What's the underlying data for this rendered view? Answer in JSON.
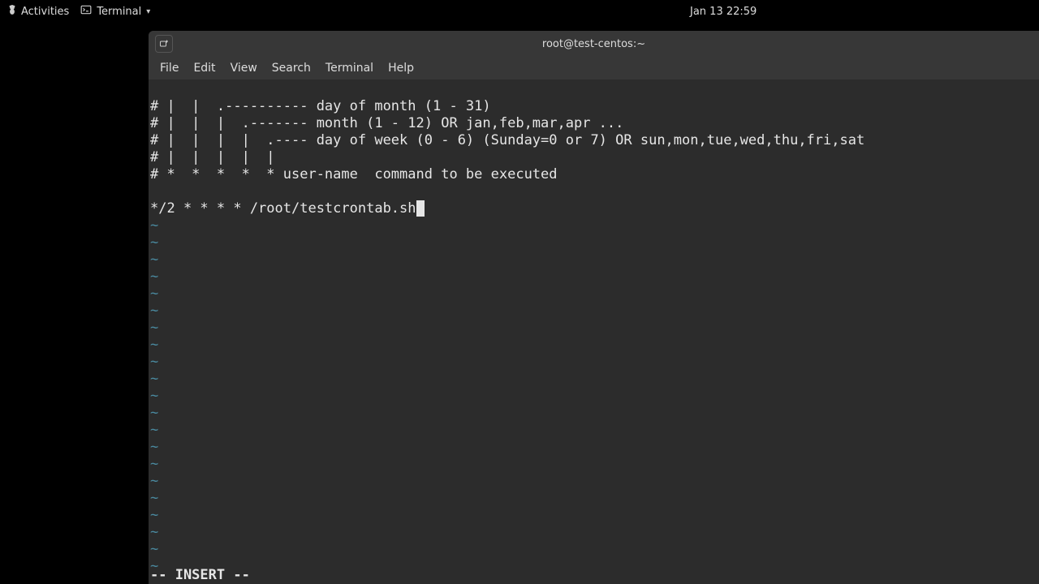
{
  "topbar": {
    "activities": "Activities",
    "app": "Terminal",
    "clock": "Jan 13  22:59"
  },
  "window": {
    "title": "root@test-centos:~"
  },
  "menubar": {
    "file": "File",
    "edit": "Edit",
    "view": "View",
    "search": "Search",
    "terminal": "Terminal",
    "help": "Help"
  },
  "editor": {
    "lines": [
      "# |  |  .---------- day of month (1 - 31)",
      "# |  |  |  .------- month (1 - 12) OR jan,feb,mar,apr ...",
      "# |  |  |  |  .---- day of week (0 - 6) (Sunday=0 or 7) OR sun,mon,tue,wed,thu,fri,sat",
      "# |  |  |  |  |",
      "# *  *  *  *  * user-name  command to be executed",
      "",
      "*/2 * * * * /root/testcrontab.sh"
    ],
    "tilde": "~",
    "status": "-- INSERT --"
  }
}
